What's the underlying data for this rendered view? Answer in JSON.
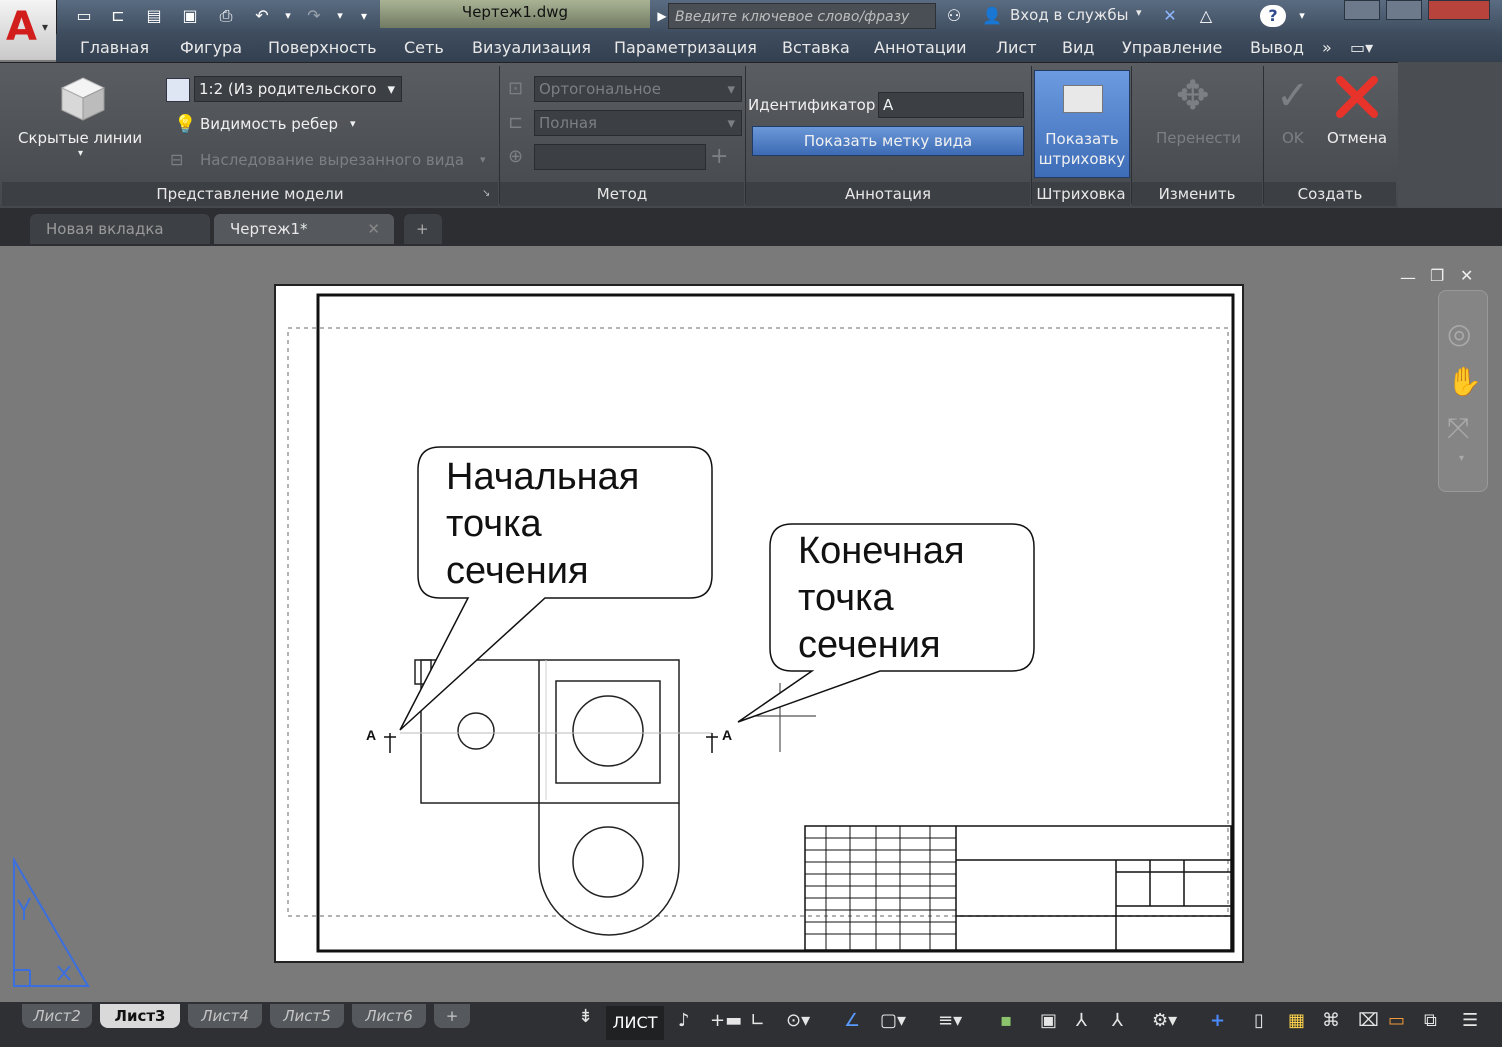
{
  "titlebar": {
    "app_logo": "A",
    "document": "Чертеж1.dwg",
    "search_placeholder": "Введите ключевое слово/фразу",
    "signin": "Вход в службы",
    "help_icon": "?"
  },
  "menu": [
    "Главная",
    "Фигура",
    "Поверхность",
    "Сеть",
    "Визуализация",
    "Параметризация",
    "Вставка",
    "Аннотации",
    "Лист",
    "Вид",
    "Управление",
    "Вывод"
  ],
  "ribbon": {
    "hidden_lines": "Скрытые линии",
    "scale_value": "1:2 (Из родительского",
    "edge_visibility": "Видимость ребер",
    "inherit_cut": "Наследование вырезанного вида",
    "projection": "Ортогональное",
    "full": "Полная",
    "identifier_label": "Идентификатор",
    "identifier_value": "A",
    "show_view_label": "Показать метку вида",
    "show_hatch_line1": "Показать",
    "show_hatch_line2": "штриховку",
    "move": "Перенести",
    "ok": "OK",
    "cancel": "Отмена",
    "panels": [
      "Представление модели",
      "Метод",
      "Аннотация",
      "Штриховка",
      "Изменить",
      "Создать"
    ]
  },
  "tabs": {
    "new_tab": "Новая вкладка",
    "drawing_tab": "Чертеж1*",
    "add": "+"
  },
  "drawing": {
    "callout_start": [
      "Начальная",
      "точка",
      "сечения"
    ],
    "callout_end": [
      "Конечная",
      "точка",
      "сечения"
    ],
    "section_label": "A"
  },
  "layouts": [
    "Лист2",
    "Лист3",
    "Лист4",
    "Лист5",
    "Лист6"
  ],
  "active_layout": "Лист3",
  "status": {
    "space": "ЛИСТ"
  },
  "colors": {
    "cancel_red": "#e8332a",
    "ucs_blue": "#3b6fe0",
    "logo_red": "#d21d1d"
  }
}
